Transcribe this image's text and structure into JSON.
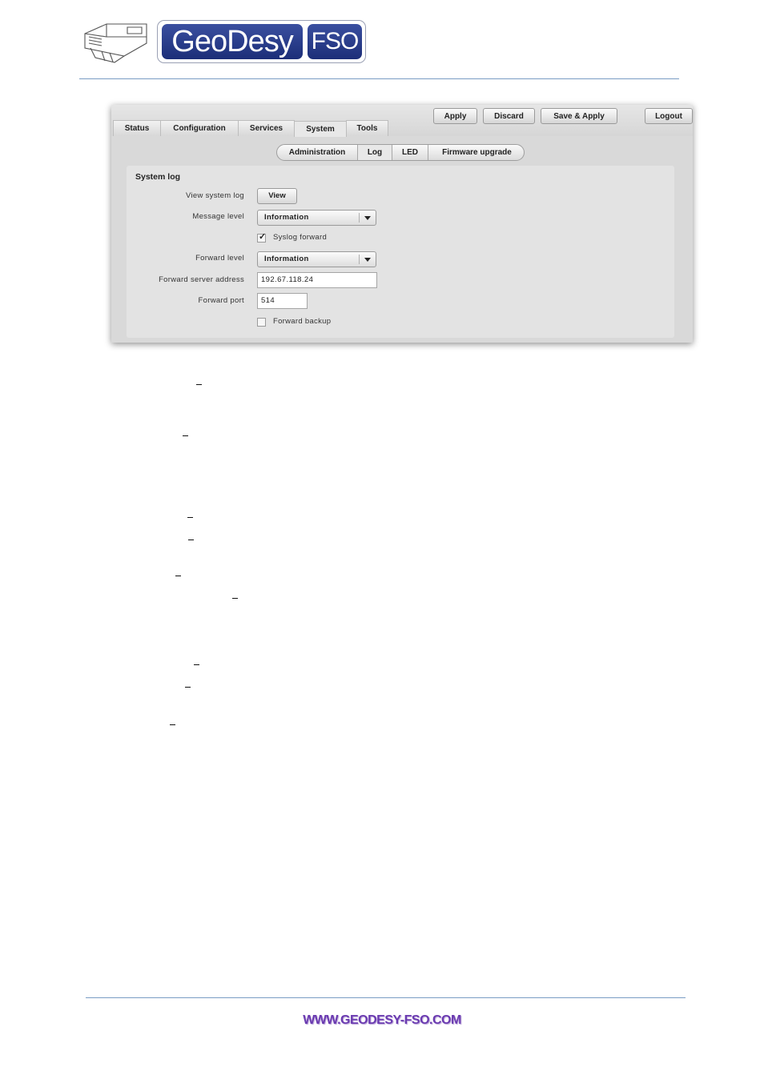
{
  "document": {
    "brand_left": "GeoDesy",
    "brand_right": "FSO",
    "footer_url": "WWW.GEODESY-FSO.COM"
  },
  "ui": {
    "nav_tabs": [
      "Status",
      "Configuration",
      "Services",
      "System",
      "Tools"
    ],
    "active_tab": "System",
    "actions": {
      "apply": "Apply",
      "discard": "Discard",
      "save_apply": "Save & Apply",
      "logout": "Logout"
    },
    "subtabs": [
      "Administration",
      "Log",
      "LED",
      "Firmware upgrade"
    ],
    "active_subtab": "Log",
    "system_log": {
      "title": "System log",
      "view_label": "View system log",
      "view_button": "View",
      "message_level_label": "Message level",
      "message_level_value": "Information",
      "syslog_forward_label": "Syslog forward",
      "syslog_forward_checked": true,
      "forward_level_label": "Forward level",
      "forward_level_value": "Information",
      "forward_server_label": "Forward server address",
      "forward_server_value": "192.67.118.24",
      "forward_port_label": "Forward port",
      "forward_port_value": "514",
      "forward_backup_label": "Forward backup",
      "forward_backup_checked": false
    }
  },
  "colors": {
    "brand_blue": "#2a3d8f",
    "footer_purple": "#6a3ab0",
    "rule_blue": "#7a9cc4"
  }
}
